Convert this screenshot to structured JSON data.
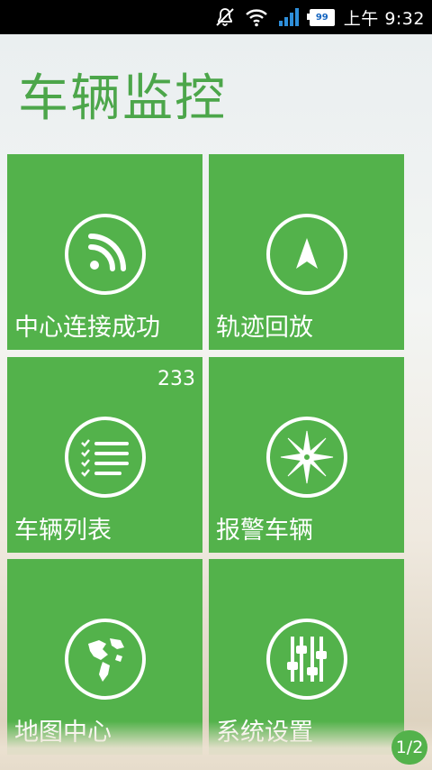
{
  "status_bar": {
    "icons": [
      "mute-icon",
      "wifi-icon",
      "signal-icon",
      "battery-icon"
    ],
    "battery": "99",
    "time": "上午 9:32"
  },
  "header": {
    "title": "车辆监控"
  },
  "tiles": [
    {
      "label": "中心连接成功",
      "icon": "rss-connection-icon"
    },
    {
      "label": "轨迹回放",
      "icon": "navigation-arrow-icon"
    },
    {
      "label": "车辆列表",
      "icon": "checklist-icon",
      "badge": "233"
    },
    {
      "label": "报警车辆",
      "icon": "compass-star-icon"
    },
    {
      "label": "地图中心",
      "icon": "globe-map-icon"
    },
    {
      "label": "系统设置",
      "icon": "sliders-icon"
    }
  ],
  "pager": {
    "text": "1/2"
  },
  "colors": {
    "tile": "#53b24b",
    "title": "#4ca64a",
    "status_bar": "#000000"
  }
}
